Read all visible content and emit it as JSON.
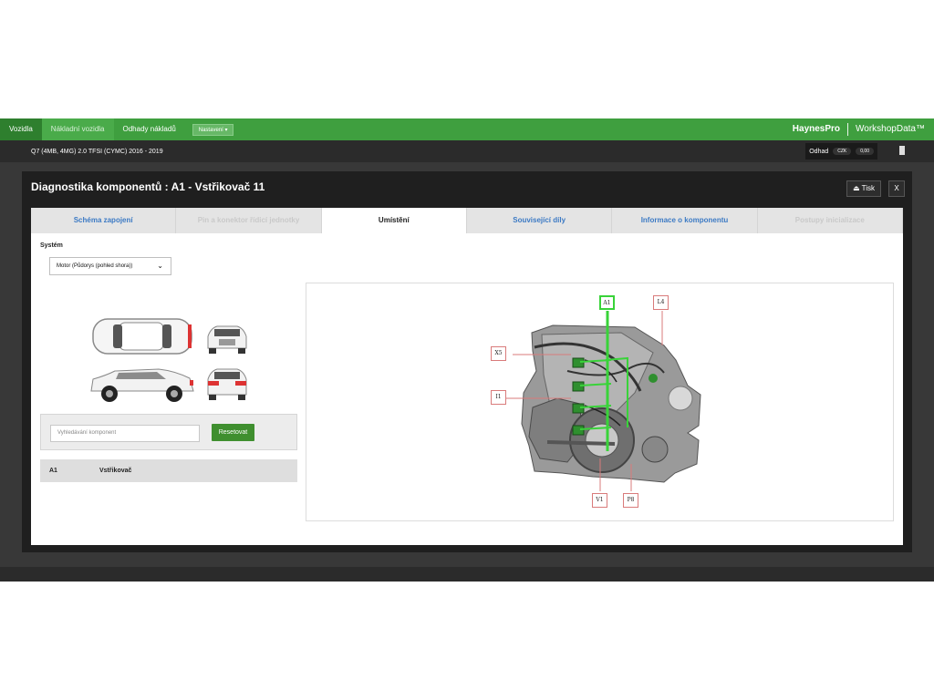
{
  "topbar": {
    "nav": [
      "Vozidla",
      "Nákladní vozidla",
      "Odhady nákladů"
    ],
    "settings_label": "Nastavení",
    "brand": "HaynesPro",
    "product": "WorkshopData™"
  },
  "vehicle": {
    "title": "Q7 (4MB, 4MG) 2.0 TFSI (CYMC) 2016 - 2019",
    "estimate_label": "Odhad",
    "currency": "CZK",
    "amount": "0,00"
  },
  "dialog": {
    "title": "Diagnostika komponentů : A1 - Vstřikovač 11",
    "print_label": "Tisk",
    "close_label": "X"
  },
  "tabs": [
    {
      "label": "Schéma zapojení"
    },
    {
      "label": "Pin a konektor řídicí jednotky"
    },
    {
      "label": "Umístění"
    },
    {
      "label": "Související díly"
    },
    {
      "label": "Informace o komponentu"
    },
    {
      "label": "Postupy inicializace"
    }
  ],
  "system": {
    "label": "Systém",
    "selected": "Motor (Půdorys (pohled shora))"
  },
  "search": {
    "placeholder": "Vyhledávání komponent",
    "reset_label": "Resetovat"
  },
  "results": [
    {
      "code": "A1",
      "name": "Vstřikovač"
    }
  ],
  "diagram": {
    "labels": [
      "A1",
      "L4",
      "X5",
      "I1",
      "V1",
      "P8"
    ],
    "highlight_color": "#39d339"
  }
}
